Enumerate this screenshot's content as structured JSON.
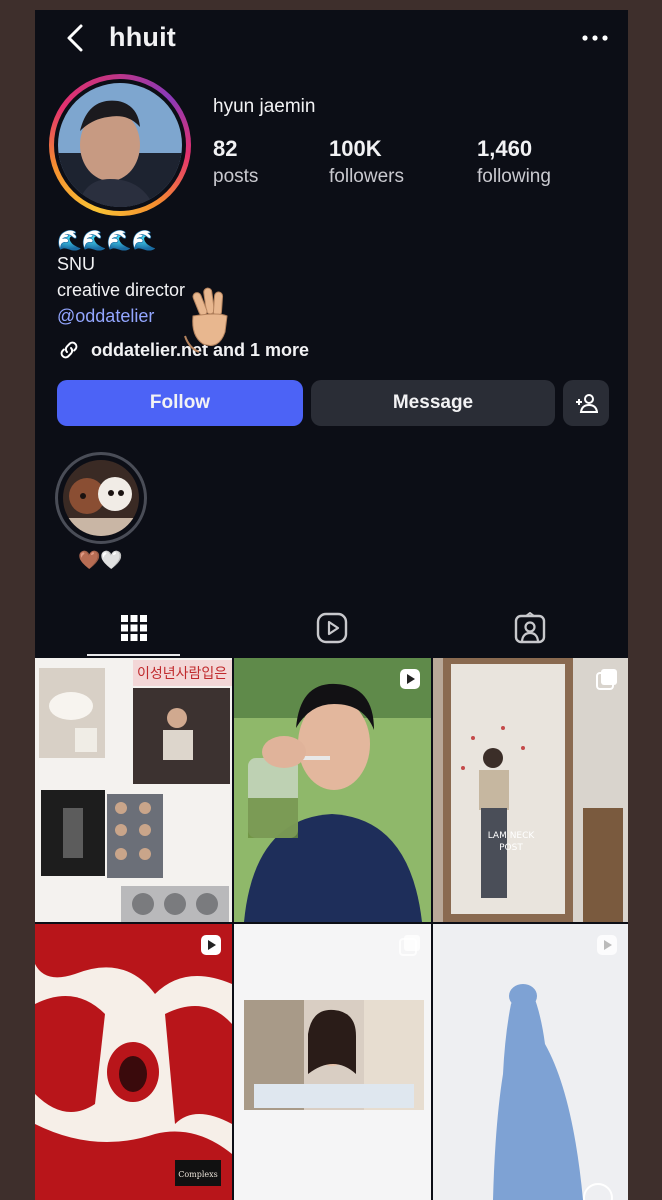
{
  "header": {
    "username": "hhuit"
  },
  "profile": {
    "full_name": "hyun jaemin",
    "stats": [
      {
        "value": "82",
        "label": "posts"
      },
      {
        "value": "100K",
        "label": "followers"
      },
      {
        "value": "1,460",
        "label": "following"
      }
    ],
    "bio": {
      "emoji": "🌊🌊🌊🌊",
      "line1": "SNU",
      "line2": "creative director",
      "mention": "@oddatelier",
      "link_text": "oddatelier.net and 1 more"
    }
  },
  "actions": {
    "follow": "Follow",
    "message": "Message"
  },
  "highlight": {
    "label": "🤎🤍"
  },
  "tabs": [
    "posts-grid",
    "reels",
    "tagged"
  ],
  "grid": {
    "rows": [
      [
        {
          "badge": "none"
        },
        {
          "badge": "reel"
        },
        {
          "badge": "carousel"
        }
      ],
      [
        {
          "badge": "reel"
        },
        {
          "badge": "carousel"
        },
        {
          "badge": "reel"
        }
      ]
    ],
    "collage_text": "이성년사람입은",
    "poster_text_1": "LAM NECK",
    "poster_text_2": "POST",
    "caption_badge": "Complexs"
  },
  "colors": {
    "background": "#0c0e16",
    "follow_button": "#4c63f6",
    "secondary_button": "#2a2d36",
    "mention": "#93a6ff"
  }
}
